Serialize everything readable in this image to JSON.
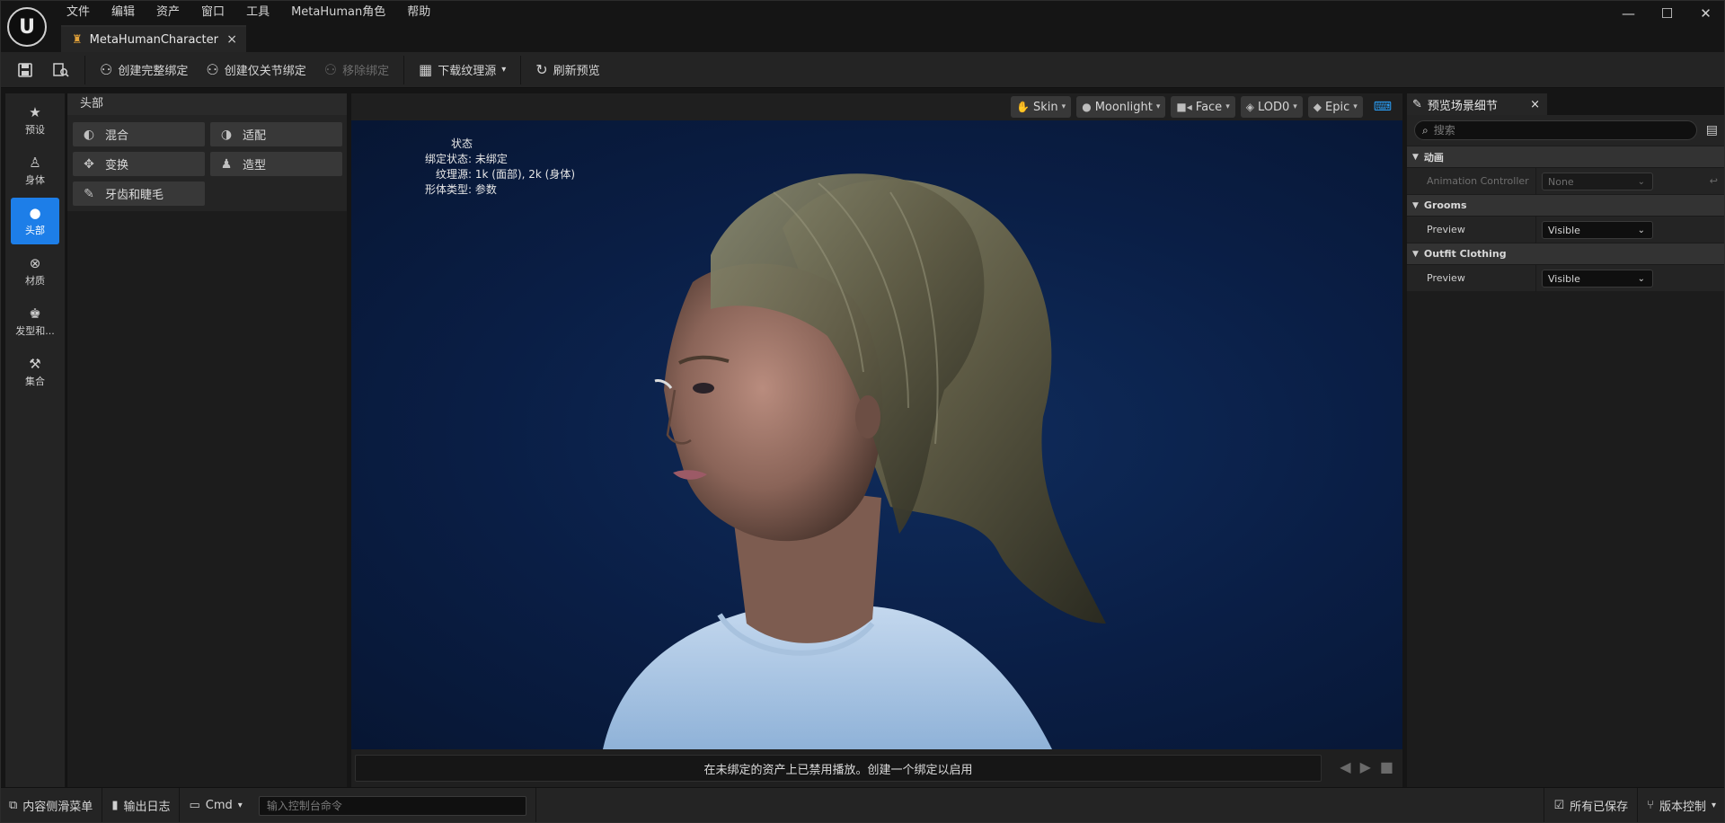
{
  "app": {
    "logo_text": "U",
    "menu": [
      "文件",
      "编辑",
      "资产",
      "窗口",
      "工具",
      "MetaHuman角色",
      "帮助"
    ],
    "window_controls": {
      "minimize": "—",
      "maximize": "☐",
      "close": "✕"
    }
  },
  "document_tab": {
    "label": "MetaHumanCharacter",
    "close": "×"
  },
  "toolbar": {
    "create_full_rig": "创建完整绑定",
    "create_joint_rig": "创建仅关节绑定",
    "remove_rig": "移除绑定",
    "download_texture_source": "下载纹理源",
    "refresh_preview": "刷新预览"
  },
  "mode_bar": {
    "items": [
      {
        "label": "预设",
        "icon": "star-icon"
      },
      {
        "label": "身体",
        "icon": "body-icon"
      },
      {
        "label": "头部",
        "icon": "head-icon",
        "active": true
      },
      {
        "label": "材质",
        "icon": "material-icon"
      },
      {
        "label": "发型和...",
        "icon": "hair-icon"
      },
      {
        "label": "集合",
        "icon": "hammer-icon"
      }
    ]
  },
  "tools_panel": {
    "header": "头部",
    "tools": [
      {
        "label": "混合",
        "icon": "blend-icon"
      },
      {
        "label": "适配",
        "icon": "conform-icon"
      },
      {
        "label": "变换",
        "icon": "move-icon"
      },
      {
        "label": "造型",
        "icon": "sculpt-icon"
      },
      {
        "label": "牙齿和睫毛",
        "icon": "brush-icon"
      }
    ]
  },
  "viewport": {
    "chips": {
      "skin": "Skin",
      "lighting": "Moonlight",
      "camera": "Face",
      "lod": "LOD0",
      "quality": "Epic"
    },
    "status": {
      "title": "状态",
      "rig_state": "绑定状态: 未绑定",
      "texture_source": "纹理源: 1k (面部), 2k (身体)",
      "body_type": "形体类型: 参数"
    },
    "message": "在未绑定的资产上已禁用播放。创建一个绑定以启用"
  },
  "details_panel": {
    "tab_label": "预览场景细节",
    "tab_close": "×",
    "search_placeholder": "搜索",
    "categories": [
      {
        "name": "动画",
        "rows": [
          {
            "name": "Animation Controller",
            "value": "None",
            "disabled": true
          }
        ]
      },
      {
        "name": "Grooms",
        "rows": [
          {
            "name": "Preview",
            "value": "Visible"
          }
        ]
      },
      {
        "name": "Outfit Clothing",
        "rows": [
          {
            "name": "Preview",
            "value": "Visible"
          }
        ]
      }
    ]
  },
  "statusbar": {
    "content_drawer": "内容侧滑菜单",
    "output_log": "输出日志",
    "cmd": "Cmd",
    "console_placeholder": "输入控制台命令",
    "all_saved": "所有已保存",
    "source_control": "版本控制"
  },
  "colors": {
    "accent": "#1d7ee8",
    "viewport_bg": "#0b1a3b",
    "panel_bg": "#242424"
  }
}
